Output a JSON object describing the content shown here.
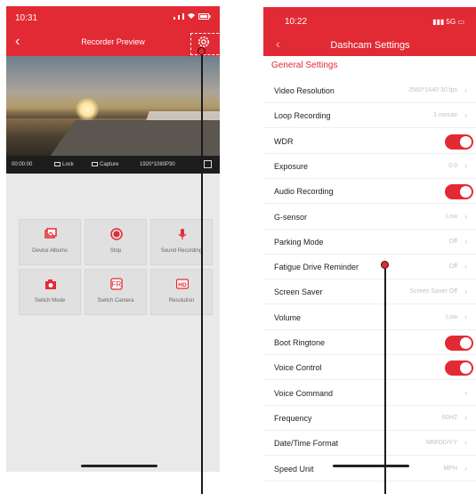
{
  "left_phone": {
    "status": {
      "time": "10:31"
    },
    "nav": {
      "title": "Recorder Preview"
    },
    "video_bar": {
      "timer": "00:00:00",
      "lock_label": "Lock",
      "capture_label": "Capture",
      "resolution_text": "1920*1080P30"
    },
    "tiles": [
      {
        "label": "Device Albums",
        "icon": "gallery-icon"
      },
      {
        "label": "Stop",
        "icon": "record-icon"
      },
      {
        "label": "Sound Recording",
        "icon": "mic-icon"
      },
      {
        "label": "Switch Mode",
        "icon": "camera-icon"
      },
      {
        "label": "Switch Camera",
        "icon": "switch-camera-icon"
      },
      {
        "label": "Resolution",
        "icon": "hd-icon"
      }
    ]
  },
  "right_phone": {
    "status": {
      "time": "10:22",
      "network": "5G"
    },
    "header": {
      "title": "Dashcam Settings"
    },
    "section_title": "General Settings",
    "rows": [
      {
        "name": "Video Resolution",
        "value": "2560*1440 30 fps",
        "type": "select"
      },
      {
        "name": "Loop Recording",
        "value": "1 minute",
        "type": "select"
      },
      {
        "name": "WDR",
        "value": "on",
        "type": "toggle"
      },
      {
        "name": "Exposure",
        "value": "0.0",
        "type": "select"
      },
      {
        "name": "Audio Recording",
        "value": "on",
        "type": "toggle"
      },
      {
        "name": "G-sensor",
        "value": "Low",
        "type": "select"
      },
      {
        "name": "Parking Mode",
        "value": "Off",
        "type": "select"
      },
      {
        "name": "Fatigue Drive Reminder",
        "value": "Off",
        "type": "select"
      },
      {
        "name": "Screen Saver",
        "value": "Screen Saver Off",
        "type": "select"
      },
      {
        "name": "Volume",
        "value": "Low",
        "type": "select"
      },
      {
        "name": "Boot Ringtone",
        "value": "on",
        "type": "toggle"
      },
      {
        "name": "Voice Control",
        "value": "on",
        "type": "toggle"
      },
      {
        "name": "Voice Command",
        "value": "",
        "type": "select"
      },
      {
        "name": "Frequency",
        "value": "60HZ",
        "type": "select"
      },
      {
        "name": "Date/Time Format",
        "value": "MM/DD/YY",
        "type": "select"
      },
      {
        "name": "Speed Unit",
        "value": "MPH",
        "type": "select"
      }
    ]
  },
  "colors": {
    "accent": "#e22a34",
    "tile_bg": "#e0e0e0",
    "screen_bg": "#e9e9e9"
  }
}
